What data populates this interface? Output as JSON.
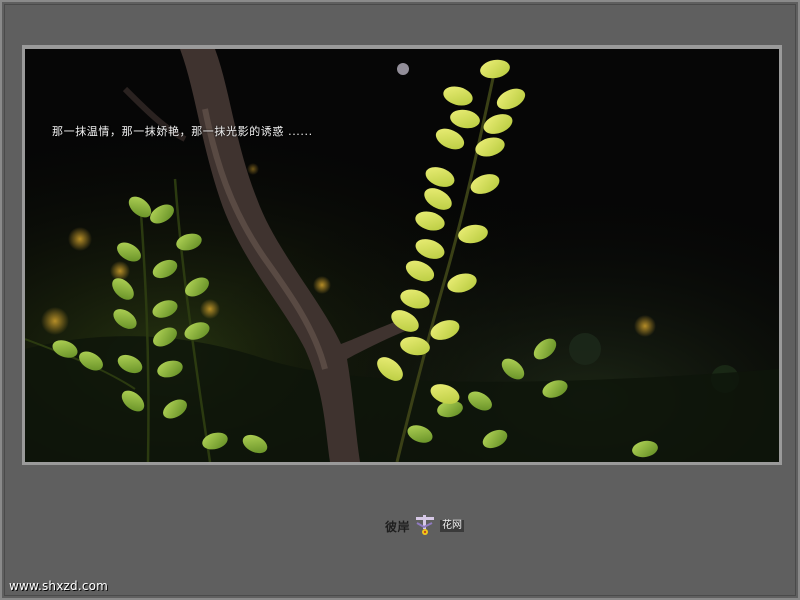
{
  "photo": {
    "caption": "那一抹温情，那一抹娇艳，那一抹光影的诱惑 ......",
    "subject": "sunlit-vine-leaves"
  },
  "logo": {
    "text_left": "彼岸",
    "text_right": "花网"
  },
  "footer": {
    "site_url": "www.shxzd.com"
  },
  "colors": {
    "background": "#5f5f5f",
    "mat": "#9a9a9a",
    "leaf_light": "#d7dc52",
    "leaf_green": "#8fb83a",
    "branch": "#4a3c36"
  }
}
